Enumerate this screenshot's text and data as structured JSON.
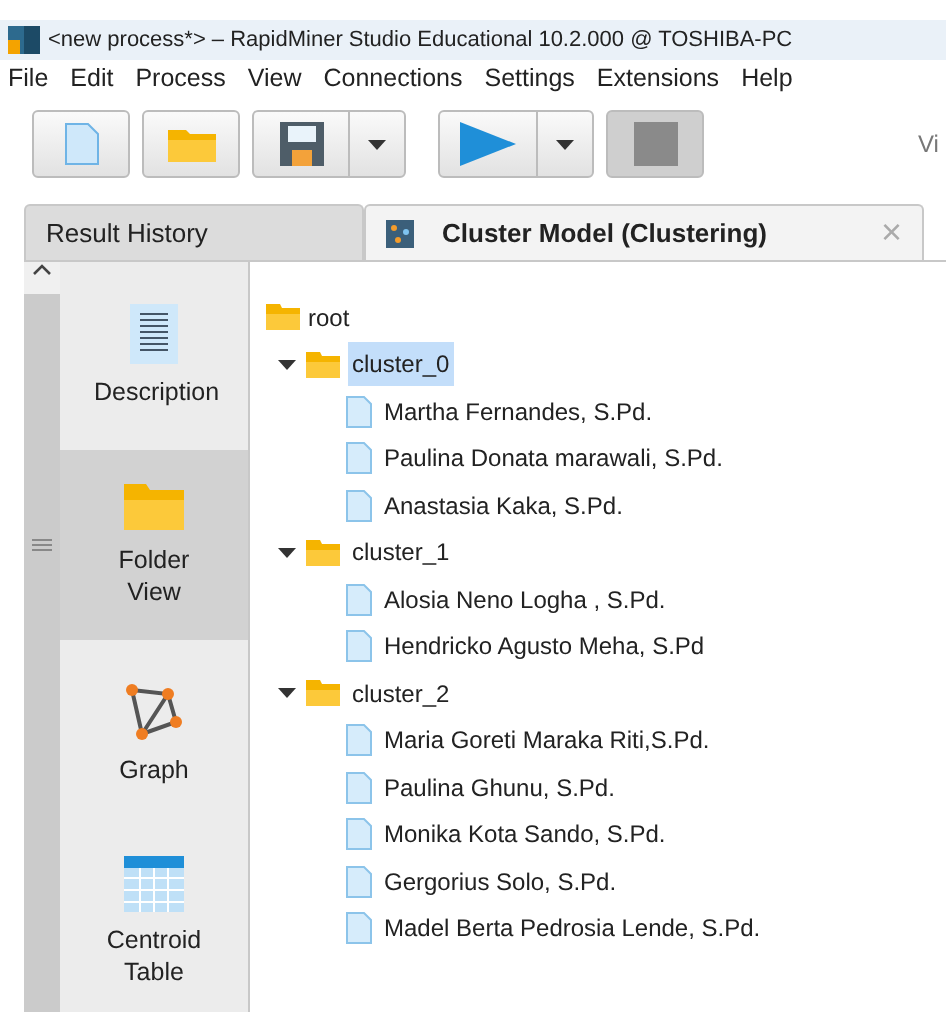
{
  "window": {
    "title": "<new process*> – RapidMiner Studio Educational 10.2.000 @ TOSHIBA-PC"
  },
  "menu": [
    {
      "label": "File"
    },
    {
      "label": "Edit"
    },
    {
      "label": "Process"
    },
    {
      "label": "View"
    },
    {
      "label": "Connections"
    },
    {
      "label": "Settings"
    },
    {
      "label": "Extensions"
    },
    {
      "label": "Help"
    }
  ],
  "toolbar": {
    "buttons": [
      {
        "kind": "new",
        "disabled": false
      },
      {
        "kind": "open",
        "disabled": false
      },
      {
        "kind": "save",
        "disabled": false
      },
      {
        "kind": "run",
        "disabled": false
      },
      {
        "kind": "stop",
        "disabled": true
      }
    ],
    "trailing_text": "Vi"
  },
  "tabs": [
    {
      "label": "Result History",
      "selected": false
    },
    {
      "label": "Cluster Model (Clustering)",
      "selected": true,
      "closable": true,
      "close_glyph": "×"
    }
  ],
  "sidebar": {
    "items": [
      {
        "label": "Description",
        "kind": "description",
        "selected": false
      },
      {
        "label": "Folder View",
        "kind": "folder",
        "selected": true
      },
      {
        "label": "Graph",
        "kind": "graph",
        "selected": false
      },
      {
        "label": "Centroid Table",
        "kind": "table",
        "selected": false
      }
    ]
  },
  "tree": {
    "label": "root",
    "children": [
      {
        "label": "cluster_0",
        "expanded": true,
        "selected": true,
        "children": [
          {
            "label": "Martha Fernandes, S.Pd."
          },
          {
            "label": "Paulina Donata marawali, S.Pd."
          },
          {
            "label": "Anastasia Kaka, S.Pd."
          }
        ]
      },
      {
        "label": "cluster_1",
        "expanded": true,
        "selected": false,
        "children": [
          {
            "label": "Alosia Neno Logha , S.Pd."
          },
          {
            "label": "Hendricko Agusto Meha, S.Pd"
          }
        ]
      },
      {
        "label": "cluster_2",
        "expanded": true,
        "selected": false,
        "children": [
          {
            "label": "Maria Goreti Maraka Riti,S.Pd."
          },
          {
            "label": "Paulina Ghunu, S.Pd."
          },
          {
            "label": "Monika Kota Sando, S.Pd."
          },
          {
            "label": "Gergorius Solo, S.Pd."
          },
          {
            "label": "Madel Berta Pedrosia Lende, S.Pd."
          }
        ]
      }
    ]
  }
}
